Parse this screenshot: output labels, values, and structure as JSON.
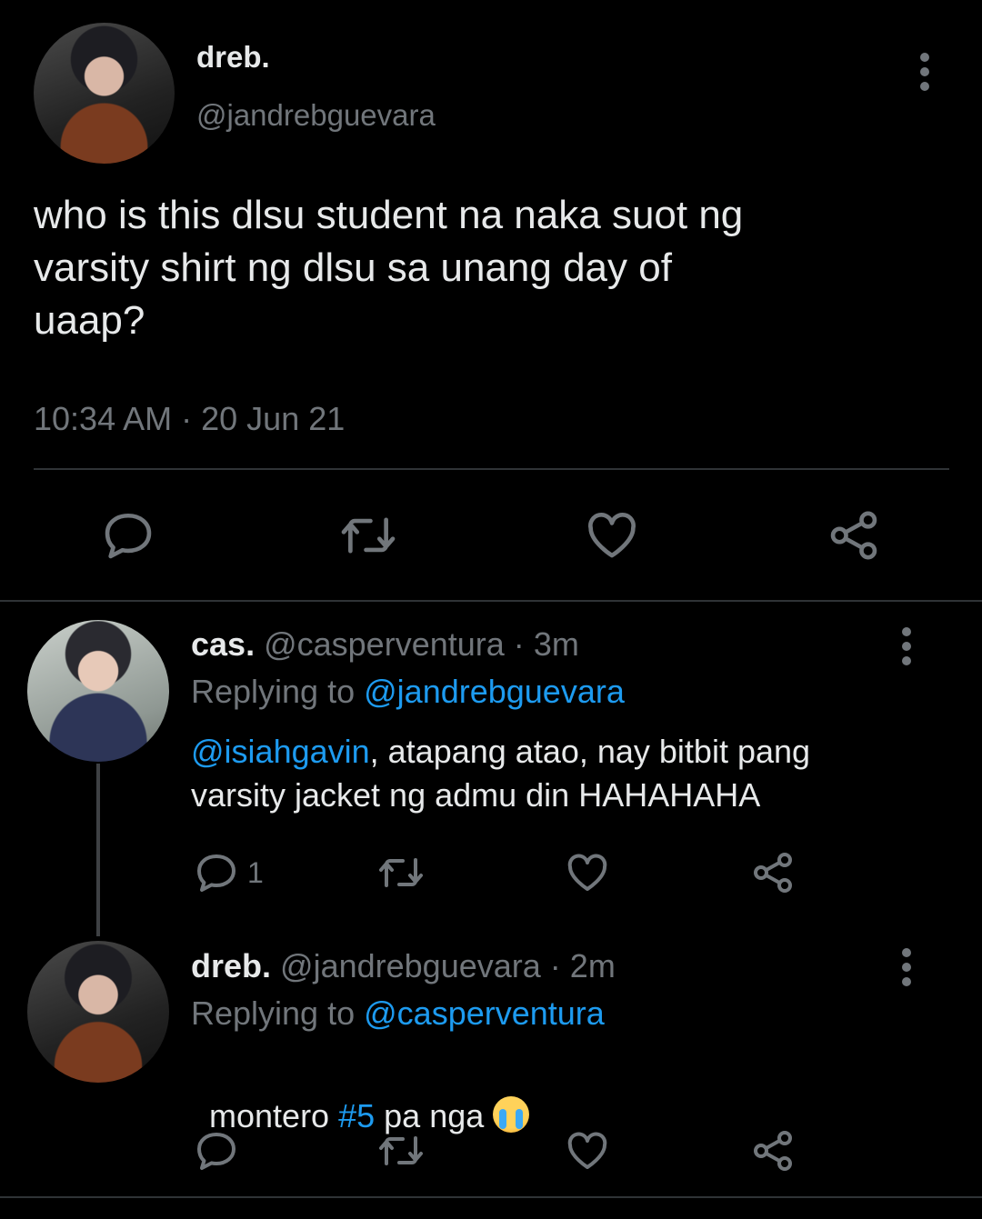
{
  "main_tweet": {
    "name": "dreb.",
    "handle": "@jandrebguevara",
    "text_line1": "who is this dlsu student na naka suot ng",
    "text_line2": "varsity shirt ng dlsu sa unang day of",
    "text_line3": "uaap?",
    "time": "10:34 AM",
    "sep": "·",
    "date": "20 Jun 21"
  },
  "reply1": {
    "name": "cas.",
    "handle": "@casperventura",
    "sep": "·",
    "age": "3m",
    "replying_prefix": "Replying to",
    "replying_to": "@jandrebguevara",
    "mention": "@isiahgavin",
    "text_rest": ", atapang atao, nay bitbit pang",
    "text_line2": "varsity jacket ng admu din HAHAHAHA",
    "reply_count": "1"
  },
  "reply2": {
    "name": "dreb.",
    "handle": "@jandrebguevara",
    "sep": "·",
    "age": "2m",
    "replying_prefix": "Replying to",
    "replying_to": "@casperventura",
    "text_pre": "montero ",
    "hashtag": "#5",
    "text_post": " pa nga",
    "emoji": "loudly-crying-face"
  },
  "icons": [
    "reply-icon",
    "retweet-icon",
    "like-icon",
    "share-icon",
    "more-icon"
  ],
  "colors": {
    "background": "#000000",
    "text": "#e7e9ea",
    "muted": "#71767b",
    "link": "#1d9bf0"
  }
}
